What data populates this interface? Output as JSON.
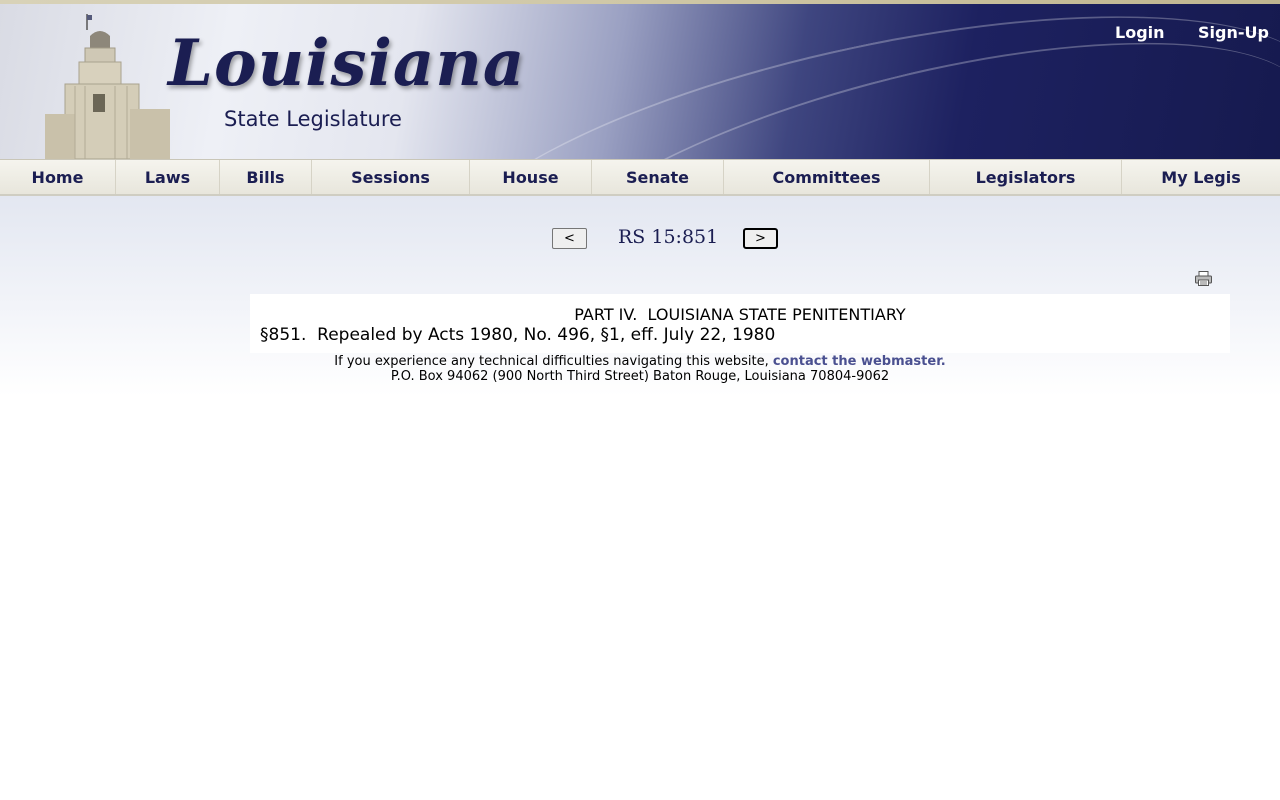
{
  "header": {
    "logo_title": "Louisiana",
    "logo_subtitle": "State Legislature",
    "login_label": "Login",
    "signup_label": "Sign-Up"
  },
  "nav": {
    "items": [
      "Home",
      "Laws",
      "Bills",
      "Sessions",
      "House",
      "Senate",
      "Committees",
      "Legislators",
      "My Legis"
    ]
  },
  "pager": {
    "prev_label": "<",
    "title": "RS 15:851",
    "next_label": ">"
  },
  "document": {
    "part_heading": "PART IV.  LOUISIANA STATE PENITENTIARY",
    "section_text": "§851.  Repealed by Acts 1980, No. 496, §1, eff. July 22, 1980"
  },
  "footer": {
    "line1_text": "If you experience any technical difficulties navigating this website, ",
    "webmaster_link": "contact the webmaster.",
    "address": "P.O. Box 94062 (900 North Third Street) Baton Rouge, Louisiana 70804-9062"
  },
  "icons": {
    "print": "printer-icon"
  },
  "colors": {
    "brand_navy": "#1b1e52",
    "link": "#4a5090"
  }
}
